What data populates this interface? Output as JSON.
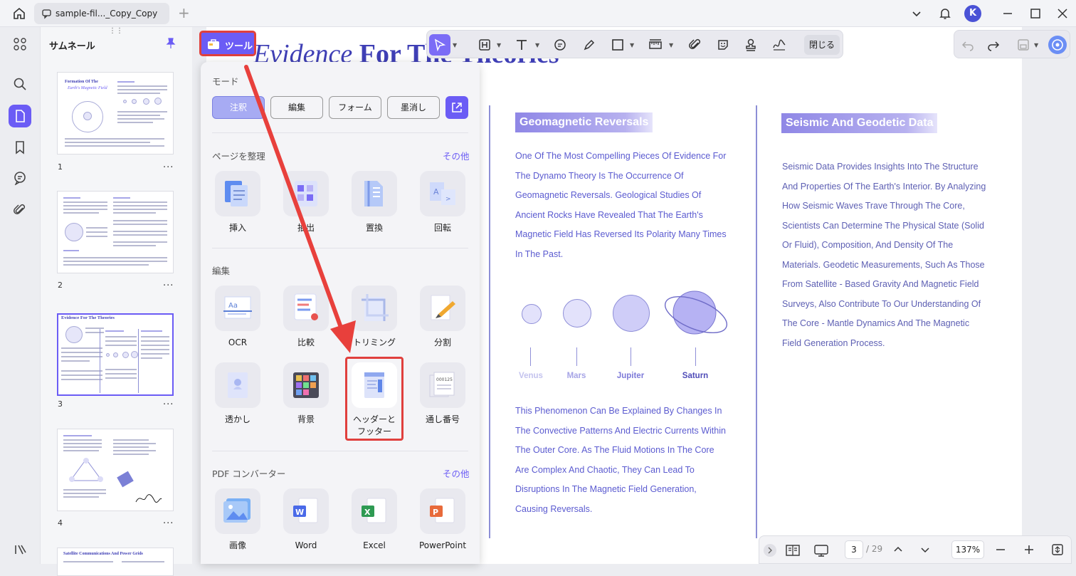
{
  "window": {
    "tab_title": "sample-fil..._Copy_Copy",
    "new_tab": "+",
    "avatar_initial": "K"
  },
  "sidebar": {
    "panel_title": "サムネール",
    "thumbnails": [
      {
        "page": "1",
        "more": "..."
      },
      {
        "page": "2",
        "more": "..."
      },
      {
        "page": "3",
        "more": "..."
      },
      {
        "page": "4",
        "more": "..."
      }
    ],
    "thumb1_title1": "Formation Of The",
    "thumb1_title2": "Earth's Magnetic Field",
    "thumb3_title": "Evidence For The Theories",
    "thumb5_title": "Satellite Communications And Power Grids"
  },
  "tool_button": {
    "label": "ツール"
  },
  "toolbar": {
    "close_label": "閉じる"
  },
  "panel": {
    "mode_title": "モード",
    "modes": [
      "注釈",
      "編集",
      "フォーム",
      "墨消し"
    ],
    "organize": {
      "title": "ページを整理",
      "more": "その他",
      "items": [
        "挿入",
        "抽出",
        "置換",
        "回転"
      ]
    },
    "edit": {
      "title": "編集",
      "items": [
        "OCR",
        "比較",
        "トリミング",
        "分割",
        "透かし",
        "背景",
        "ヘッダーと\nフッター",
        "通し番号"
      ]
    },
    "converter": {
      "title": "PDF コンバーター",
      "more": "その他",
      "items": [
        "画像",
        "Word",
        "Excel",
        "PowerPoint"
      ]
    }
  },
  "document": {
    "heading_italic": "Evidence",
    "heading_rest": " For The Theories",
    "left_title": "Geomagnetic Reversals",
    "left_para1": "One Of The Most Compelling Pieces Of Evidence For The Dynamo Theory Is The Occurrence Of Geomagnetic Reversals. Geological Studies Of Ancient Rocks Have Revealed That The Earth's Magnetic Field Has Reversed Its Polarity Many Times In The Past.",
    "planets": [
      "Venus",
      "Mars",
      "Jupiter",
      "Saturn"
    ],
    "left_para2": "This Phenomenon Can Be Explained By Changes In The Convective Patterns And Electric Currents Within The Outer Core. As The Fluid Motions In The Core Are Complex And Chaotic, They Can Lead To Disruptions In The Magnetic Field Generation, Causing Reversals.",
    "right_title": "Seismic And Geodetic Data",
    "right_para": "Seismic Data Provides Insights Into The Structure And Properties Of The Earth's Interior. By Analyzing How Seismic Waves Trave Through The Core, Scientists Can Determine The Physical State (Solid Or Fluid), Composition, And Density Of The Materials. Geodetic Measurements, Such As Those From Satellite - Based Gravity And Magnetic Field Surveys, Also Contribute To Our Understanding Of The Core - Mantle Dynamics And The Magnetic Field Generation Process."
  },
  "navigation": {
    "current_page": "3",
    "total_pages": "/ 29",
    "zoom": "137%"
  },
  "colors": {
    "accent": "#6b5cf5",
    "highlight_red": "#e0403d",
    "doc_text": "#5b5bd0"
  }
}
